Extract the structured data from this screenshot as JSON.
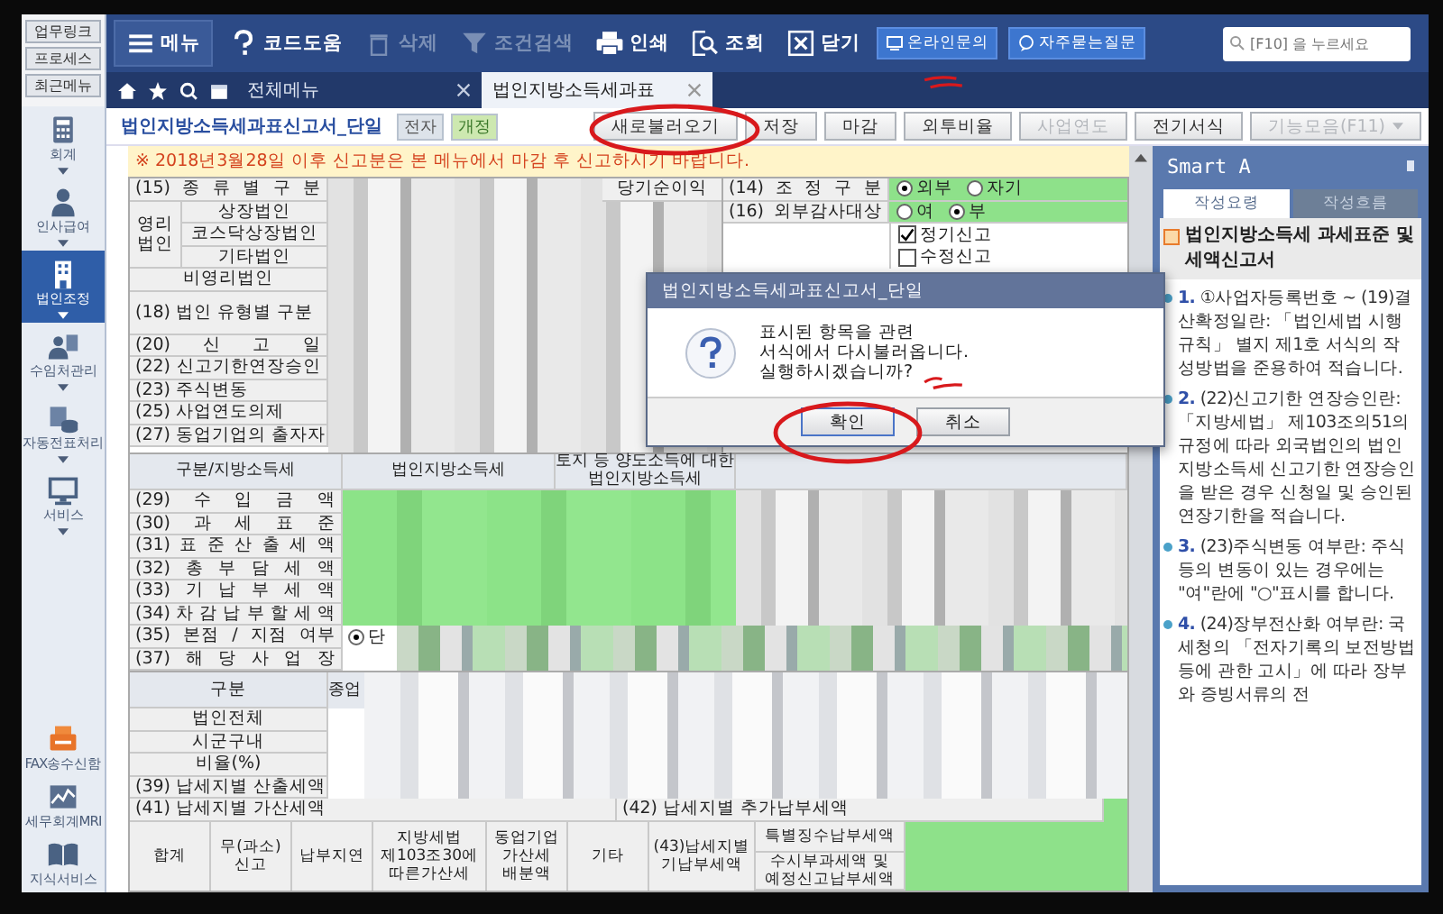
{
  "sidebar": {
    "links": [
      {
        "label": "업무링크"
      },
      {
        "label": "프로세스"
      },
      {
        "label": "최근메뉴"
      }
    ],
    "modules": [
      {
        "label": "회계",
        "selected": false
      },
      {
        "label": "인사급여",
        "selected": false
      },
      {
        "label": "법인조정",
        "selected": true
      },
      {
        "label": "수임처관리",
        "selected": false
      },
      {
        "label": "자동전표처리",
        "selected": false
      },
      {
        "label": "서비스",
        "selected": false
      }
    ],
    "bottom": [
      {
        "label": "FAX송수신함"
      },
      {
        "label": "세무회계MRI"
      },
      {
        "label": "지식서비스"
      }
    ]
  },
  "toolbar": {
    "buttons": [
      {
        "label": "메뉴",
        "disabled": false
      },
      {
        "label": "코드도움",
        "disabled": false
      },
      {
        "label": "삭제",
        "disabled": true
      },
      {
        "label": "조건검색",
        "disabled": true
      },
      {
        "label": "인쇄",
        "disabled": false
      },
      {
        "label": "조회",
        "disabled": false
      },
      {
        "label": "닫기",
        "disabled": false
      }
    ],
    "links": [
      {
        "label": "온라인문의"
      },
      {
        "label": "자주묻는질문"
      }
    ],
    "search": {
      "placeholder": "[F10] 을 누르세요"
    }
  },
  "tabs": {
    "all_menu": "전체메뉴",
    "items": [
      {
        "label": "법인지방소득세과표",
        "selected": true
      }
    ]
  },
  "form_title": "법인지방소득세과표신고서_단일",
  "badges": [
    {
      "label": "전자",
      "kind": "plain"
    },
    {
      "label": "개정",
      "kind": "revised"
    }
  ],
  "actions": [
    {
      "label": "새로불러오기",
      "disabled": false,
      "menu": false
    },
    {
      "label": "저장",
      "disabled": false,
      "menu": false
    },
    {
      "label": "마감",
      "disabled": false,
      "menu": false
    },
    {
      "label": "외투비율",
      "disabled": false,
      "menu": false
    },
    {
      "label": "사업연도",
      "disabled": true,
      "menu": false
    },
    {
      "label": "전기서식",
      "disabled": false,
      "menu": false
    },
    {
      "label": "기능모음(F11)",
      "disabled": true,
      "menu": true
    }
  ],
  "notice": "※ 2018년3월28일 이후 신고분은 본 메뉴에서 마감 후 신고하시기 바랍니다.",
  "section1": {
    "header": "(15) 종 류 별 구 분",
    "visible_column": "당기순이익",
    "for_profit": {
      "label": "영리법인",
      "rows": [
        "상장법인",
        "코스닥상장법인",
        "기타법인"
      ]
    },
    "rows": [
      {
        "label": "비영리법인",
        "kind": "center"
      },
      {
        "label": "(18) 법인 유형별 구분",
        "kind": "tall"
      },
      {
        "label": "(20) 신 고 일",
        "kind": "spread"
      },
      {
        "label": "(22) 신고기한연장승인",
        "kind": "spread"
      },
      {
        "label": "(23) 주식변동",
        "kind": "plain"
      },
      {
        "label": "(25) 사업연도의제",
        "kind": "plain"
      },
      {
        "label": "(27) 동업기업의 출자자",
        "kind": "plain"
      }
    ],
    "radio_rows": [
      {
        "label": "(14) 조 정 구 분",
        "options": [
          {
            "label": "외부",
            "selected": true
          },
          {
            "label": "자기",
            "selected": false
          }
        ]
      },
      {
        "label": "(16) 외부감사대상",
        "options": [
          {
            "label": "여",
            "selected": false
          },
          {
            "label": "부",
            "selected": true
          }
        ]
      }
    ],
    "checkboxes": [
      {
        "label": "정기신고",
        "checked": true
      },
      {
        "label": "수정신고",
        "checked": false
      }
    ]
  },
  "section2": {
    "columns": [
      "구분/지방소득세",
      "법인지방소득세",
      "토지 등 양도소득에 대한 법인지방소득세"
    ],
    "rows": [
      "(29) 수 입 금 액",
      "(30) 과 세 표 준",
      "(31) 표 준 산 출 세 액",
      "(32) 총 부 담 세 액",
      "(33) 기 납 부 세 액",
      "(34) 차 감 납 부 할 세 액"
    ],
    "branch": {
      "label": "(35) 본점 / 지점 여부",
      "option": {
        "label": "단",
        "selected": true
      }
    },
    "site": "(37) 해 당 사 업 장"
  },
  "section3": {
    "header": "구분",
    "column_2": "종업",
    "rows": [
      "법인전체",
      "시군구내",
      "비율(%)"
    ],
    "computed": "(39) 납세지별 산출세액",
    "penalty": "(41) 납세지별 가산세액",
    "additional": "(42) 납세지별 추가납부세액",
    "columns": [
      "합계",
      "무(과소)\n신고",
      "납부지연",
      "지방세법\n제103조30에\n따른가산세",
      "동업기업\n가산세\n배분액",
      "기타",
      "(43)납세지별\n기납부세액"
    ],
    "last_column": [
      "특별징수납부세액",
      "수시부과세액 및\n예정신고납부세액"
    ]
  },
  "dialog": {
    "title": "법인지방소득세과표신고서_단일",
    "lines": [
      "표시된 항목을 관련",
      "서식에서 다시불러옵니다.",
      "실행하시겠습니까?"
    ],
    "buttons": [
      {
        "label": "확인",
        "selected": true
      },
      {
        "label": "취소",
        "selected": false
      }
    ]
  },
  "smart": {
    "title": "Smart A",
    "tabs": [
      {
        "label": "작성요령",
        "selected": true
      },
      {
        "label": "작성흐름",
        "selected": false
      }
    ],
    "heading": "법인지방소득세 과세표준 및 세액신고서",
    "items": [
      {
        "number": "1.",
        "text": "①사업자등록번호 ~ (19)결산확정일란: 「법인세법 시행규칙」 별지 제1호 서식의 작성방법을 준용하여 적습니다."
      },
      {
        "number": "2.",
        "text": "(22)신고기한 연장승인란: 「지방세법」 제103조의51의 규정에 따라 외국법인의 법인지방소득세 신고기한 연장승인을 받은 경우 신청일 및 승인된 연장기한을 적습니다."
      },
      {
        "number": "3.",
        "text": "(23)주식변동 여부란: 주식 등의 변동이 있는 경우에는 \"여\"란에 \"○\"표시를 합니다."
      },
      {
        "number": "4.",
        "text": "(24)장부전산화 여부란: 국세청의 「전자기록의 보전방법 등에 관한 고시」에 따라 장부와 증빙서류의 전"
      }
    ]
  }
}
